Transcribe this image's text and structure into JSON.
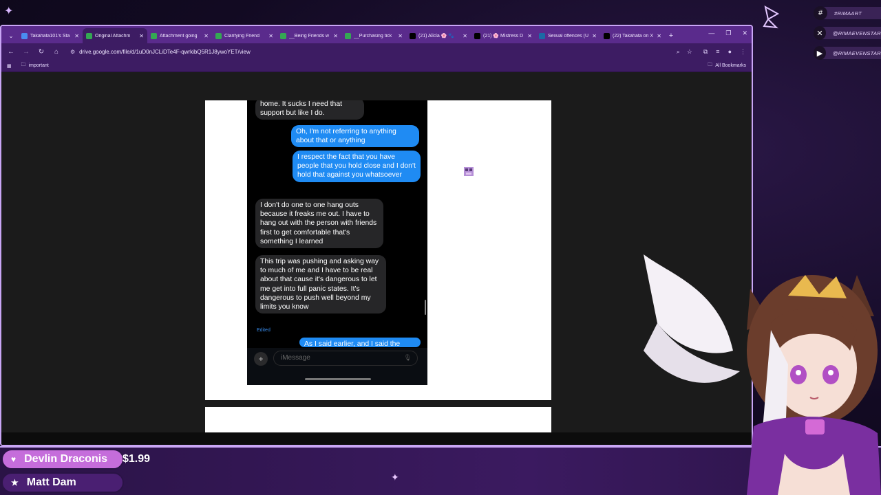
{
  "browser": {
    "tabs": [
      {
        "label": "Takahata101's Sta",
        "icon_color": "#4a8cf0",
        "active": false
      },
      {
        "label": "Original Attachm",
        "icon_color": "#34a853",
        "active": true
      },
      {
        "label": "Attachment going",
        "icon_color": "#34a853",
        "active": false
      },
      {
        "label": "Clarifying Friend",
        "icon_color": "#34a853",
        "active": false
      },
      {
        "label": "__Being Friends w",
        "icon_color": "#34a853",
        "active": false
      },
      {
        "label": "__Purchasing tick",
        "icon_color": "#34a853",
        "active": false
      },
      {
        "label": "(21) Alicia 🌸 🐾",
        "icon_color": "#000000",
        "active": false
      },
      {
        "label": "(21) 🌸 Mistress D",
        "icon_color": "#000000",
        "active": false
      },
      {
        "label": "Sexual offences (U",
        "icon_color": "#1b6aa5",
        "active": false
      },
      {
        "label": "(22) Takahata on X",
        "icon_color": "#000000",
        "active": false
      }
    ],
    "url": "drive.google.com/file/d/1uD0nJCLiDTe4F-qwrkibQ5R1J8ywoYET/view",
    "bookmarks": {
      "left": "important",
      "right": "All Bookmarks"
    }
  },
  "chat": {
    "messages": [
      {
        "side": "in",
        "text": "home. It sucks I need that support but like I do."
      },
      {
        "side": "out",
        "text": "Oh, I'm not referring to anything about that or anything"
      },
      {
        "side": "out",
        "text": "I respect the fact that you have people that you hold close and I don't hold that against you whatsoever"
      },
      {
        "side": "in",
        "text": "I don't do one to one hang outs because it freaks me out. I have to hang out with the person with friends first to get comfortable that's something I learned"
      },
      {
        "side": "in",
        "text": "This trip was pushing and asking way to much of me and I have to be real about that cause it's dangerous to let me get into full panic states. It's dangerous to push well beyond my limits you know"
      },
      {
        "side": "out",
        "text": "As I said earlier, and I said the"
      }
    ],
    "edited_label": "Edited",
    "composer_placeholder": "iMessage"
  },
  "social": [
    {
      "icon": "hashtag-icon",
      "glyph": "#",
      "handle": "#RIMAART"
    },
    {
      "icon": "x-icon",
      "glyph": "✕",
      "handle": "@RIMAEVENSTAR"
    },
    {
      "icon": "youtube-icon",
      "glyph": "▶",
      "handle": "@RIMAEVENSTAR"
    }
  ],
  "alerts": [
    {
      "icon": "heart-icon",
      "glyph": "♥",
      "name": "Devlin Draconis",
      "amount": "$1.99"
    },
    {
      "icon": "star-icon",
      "glyph": "★",
      "name": "Matt Dam",
      "amount": ""
    }
  ],
  "colors": {
    "accent": "#c9a6f5",
    "browser_chrome": "#3d1c63",
    "imessage_blue": "#1f8bf3",
    "imessage_gray": "#262628"
  }
}
